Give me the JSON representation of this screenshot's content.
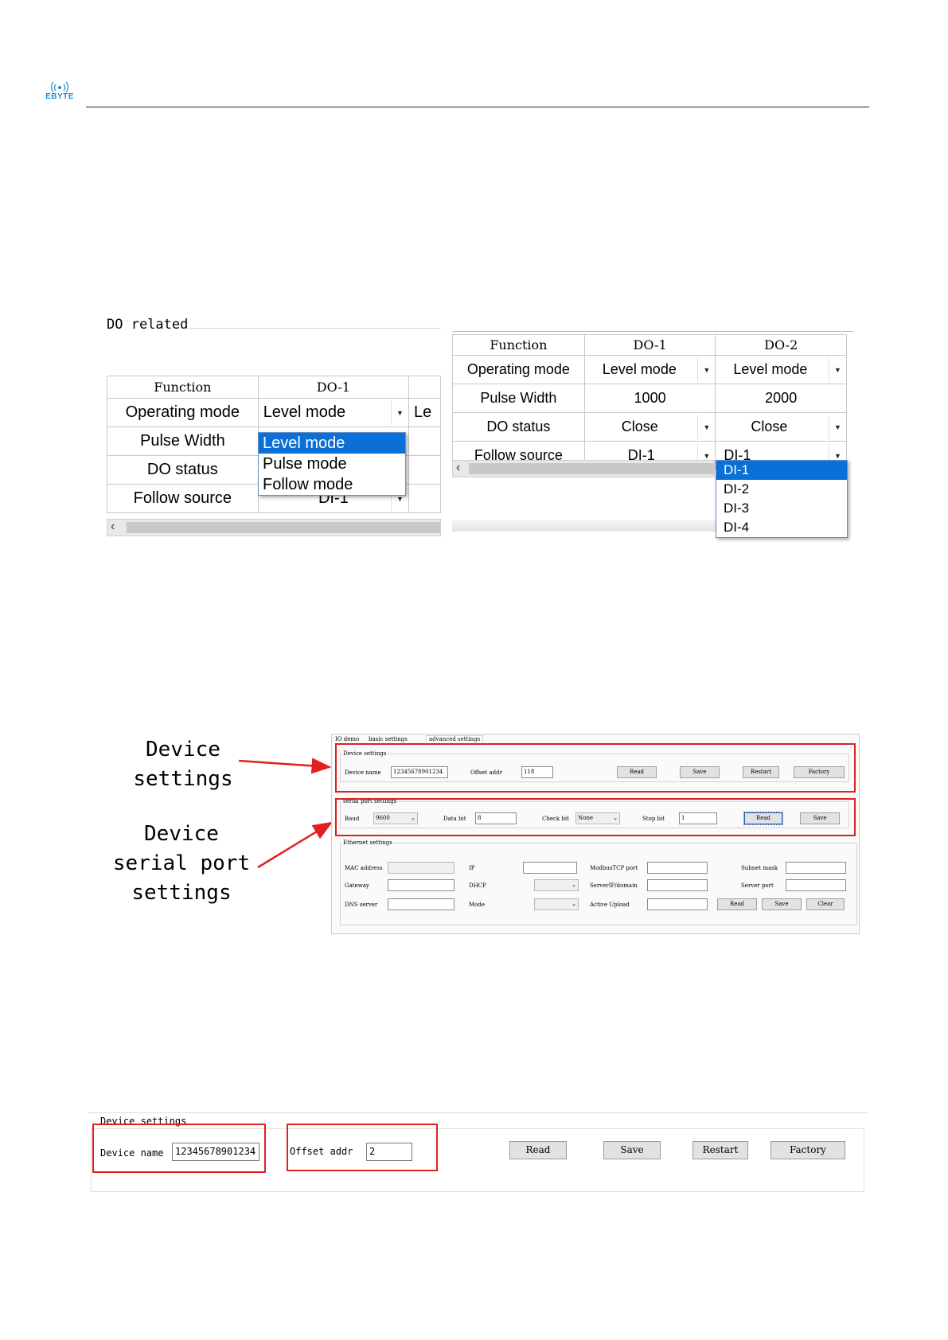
{
  "header": {
    "brand": "EBYTE"
  },
  "fig1_left": {
    "group_title": "DO related",
    "columns": [
      "Function",
      "DO-1"
    ],
    "rows": [
      {
        "label": "Operating mode",
        "value": "Level mode"
      },
      {
        "label": "Pulse Width",
        "value": ""
      },
      {
        "label": "DO status",
        "value": ""
      },
      {
        "label": "Follow source",
        "value": "DI-1"
      }
    ],
    "clipped_text": "Le",
    "dropdown_options": [
      "Level mode",
      "Pulse mode",
      "Follow mode"
    ]
  },
  "fig1_right": {
    "columns": [
      "Function",
      "DO-1",
      "DO-2"
    ],
    "rows": [
      {
        "label": "Operating mode",
        "do1": "Level mode",
        "do2": "Level mode"
      },
      {
        "label": "Pulse Width",
        "do1": "1000",
        "do2": "2000"
      },
      {
        "label": "DO status",
        "do1": "Close",
        "do2": "Close"
      },
      {
        "label": "Follow source",
        "do1": "DI-1",
        "do2": "DI-1"
      }
    ],
    "dropdown_options": [
      "DI-1",
      "DI-2",
      "DI-3",
      "DI-4"
    ]
  },
  "fig2": {
    "callout_device": [
      "Device",
      "settings"
    ],
    "callout_serial": [
      "Device",
      "serial port",
      "settings"
    ],
    "tabs": [
      "IO demo",
      "basic settings",
      "advanced settings"
    ],
    "device": {
      "title": "Device settings",
      "name_label": "Device name",
      "name_value": "12345678901234",
      "offset_label": "Offset addr",
      "offset_value": "118",
      "buttons": [
        "Read",
        "Save",
        "Restart",
        "Factory"
      ]
    },
    "serial": {
      "title": "serial port settings",
      "baud_label": "Baud",
      "baud_value": "9600",
      "databit_label": "Data bit",
      "databit_value": "8",
      "checkbit_label": "Check bit",
      "checkbit_value": "None",
      "stopbit_label": "Stop bit",
      "stopbit_value": "1",
      "buttons": [
        "Read",
        "Save"
      ]
    },
    "ethernet": {
      "title": "Ethernet settings",
      "labels": [
        "MAC address",
        "IP",
        "ModbusTCP port",
        "Subnet mask",
        "Gateway",
        "DHCP",
        "ServerIP/domain",
        "Server port",
        "DNS server",
        "Mode",
        "Active Upload"
      ],
      "buttons": [
        "Read",
        "Save",
        "Clear"
      ]
    }
  },
  "fig3": {
    "title": "Device settings",
    "name_label": "Device name",
    "name_value": "12345678901234",
    "offset_label": "Offset addr",
    "offset_value": "2",
    "buttons": [
      "Read",
      "Save",
      "Restart",
      "Factory"
    ]
  },
  "colors": {
    "highlight": "#e02020",
    "selection": "#0a6fd6",
    "logo": "#1a8fd6"
  }
}
